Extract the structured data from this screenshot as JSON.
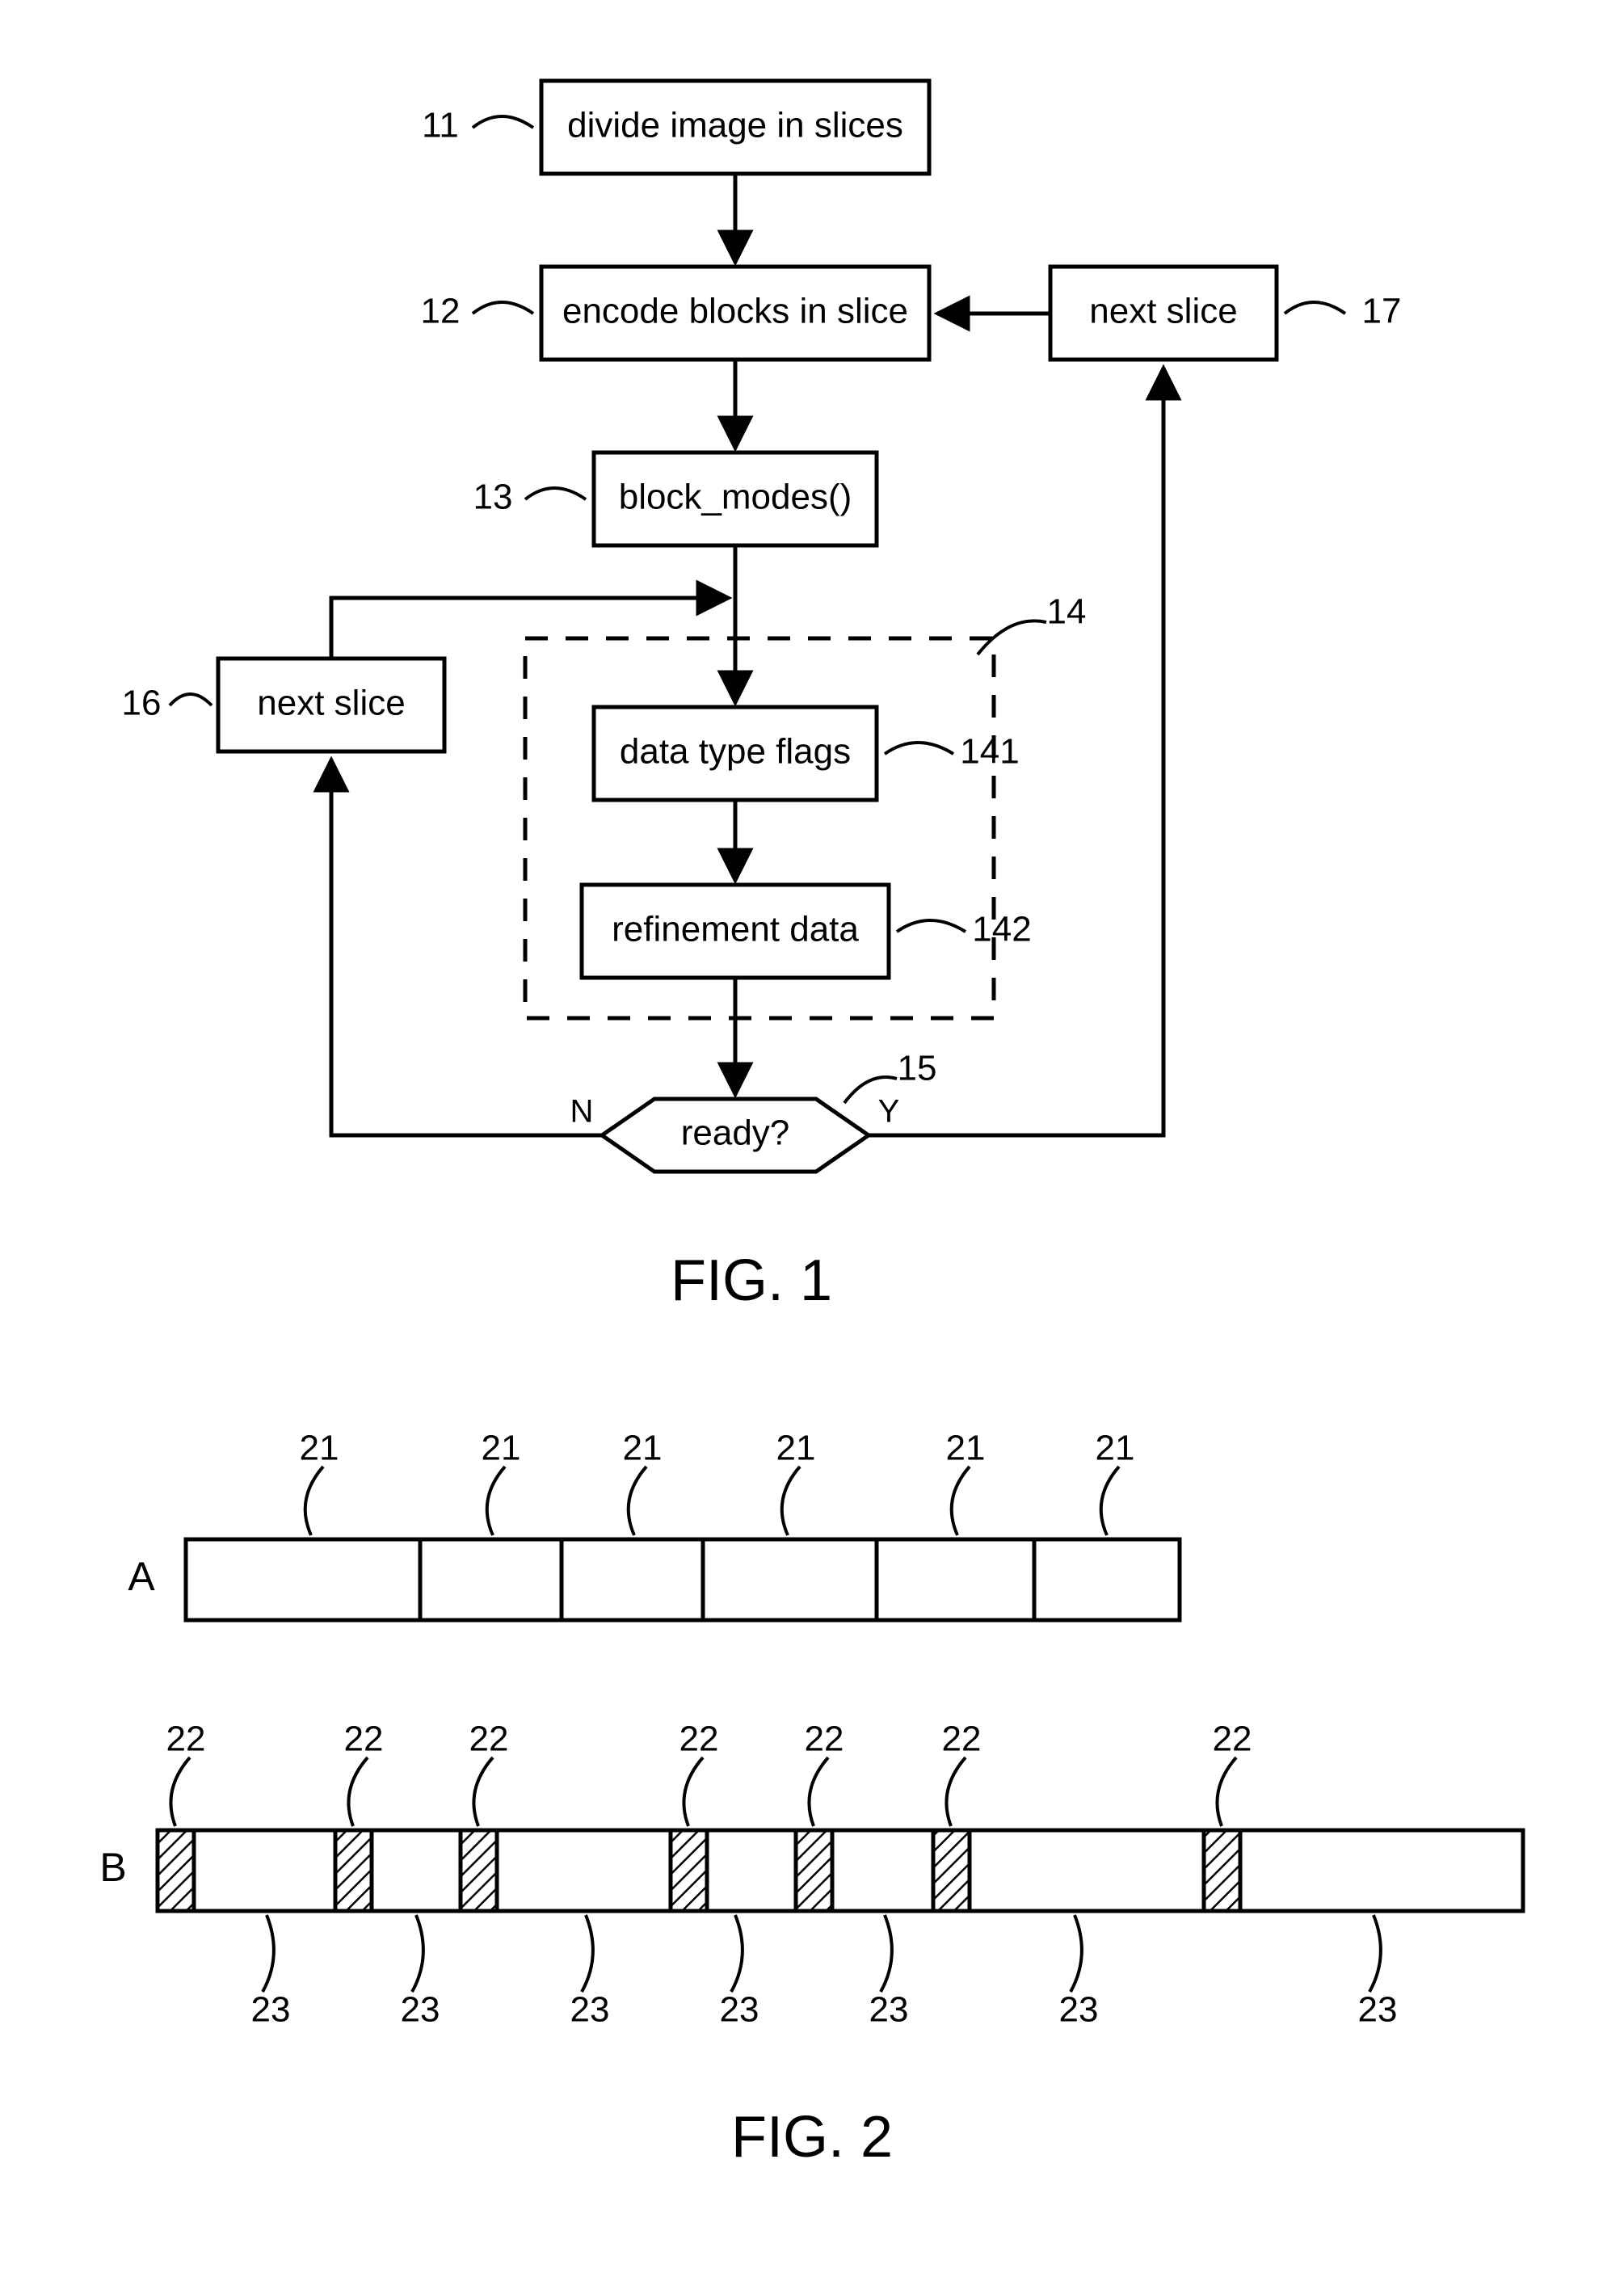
{
  "fig1": {
    "caption": "FIG. 1",
    "boxes": {
      "b11": {
        "ref": "11",
        "label": "divide image in slices"
      },
      "b12": {
        "ref": "12",
        "label": "encode blocks in slice"
      },
      "b13": {
        "ref": "13",
        "label": "block_modes()"
      },
      "b141": {
        "ref": "141",
        "label": "data type flags"
      },
      "b142": {
        "ref": "142",
        "label": "refinement data"
      },
      "b16": {
        "ref": "16",
        "label": "next slice"
      },
      "b17": {
        "ref": "17",
        "label": "next slice"
      }
    },
    "group14_ref": "14",
    "decision": {
      "ref": "15",
      "label": "ready?",
      "no": "N",
      "yes": "Y"
    }
  },
  "fig2": {
    "caption": "FIG. 2",
    "rowA": {
      "label": "A",
      "seg_ref": "21",
      "count": 6
    },
    "rowB": {
      "label": "B",
      "shaded_ref": "22",
      "plain_ref": "23",
      "shaded_count": 7,
      "plain_count": 7
    }
  }
}
